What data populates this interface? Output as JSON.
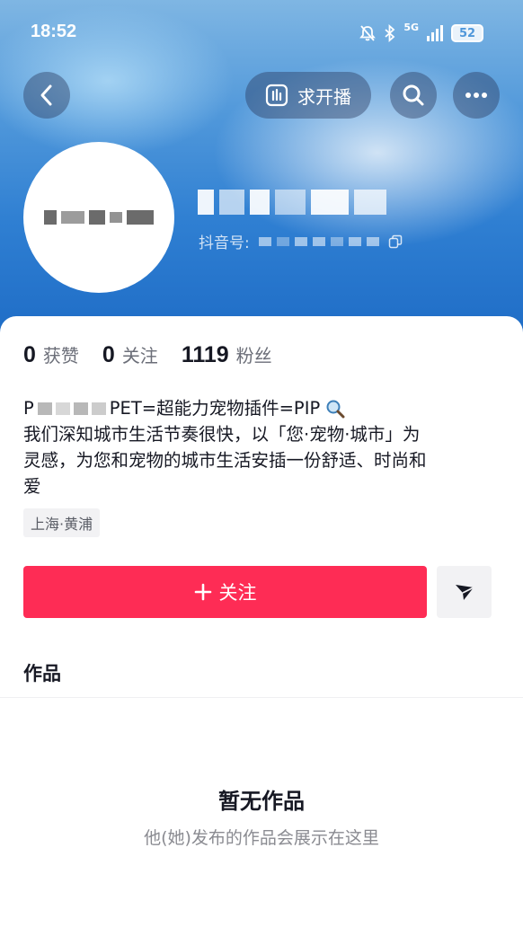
{
  "status_bar": {
    "time": "18:52",
    "network": "5G",
    "battery": "52"
  },
  "header": {
    "live_label": "求开播",
    "douyin_id_label": "抖音号:"
  },
  "stats": [
    {
      "value": "0",
      "label": "获赞"
    },
    {
      "value": "0",
      "label": "关注"
    },
    {
      "value": "1119",
      "label": "粉丝"
    }
  ],
  "bio": {
    "line1_prefix": "P",
    "line1_rest": "PET=超能力宠物插件=PIP",
    "line1_icon": "magnifier-icon",
    "line2": "我们深知城市生活节奏很快，以「您·宠物·城市」为",
    "line3": "灵感，为您和宠物的城市生活安插一份舒适、时尚和",
    "line4": "爱"
  },
  "location": "上海·黄浦",
  "actions": {
    "follow_label": "关注",
    "follow_icon": "plus-icon",
    "message_icon": "send-icon"
  },
  "works": {
    "title": "作品",
    "empty_title": "暂无作品",
    "empty_subtitle": "他(她)发布的作品会展示在这里"
  },
  "colors": {
    "accent": "#fe2c55",
    "header_blue": "#2f7fd2"
  }
}
